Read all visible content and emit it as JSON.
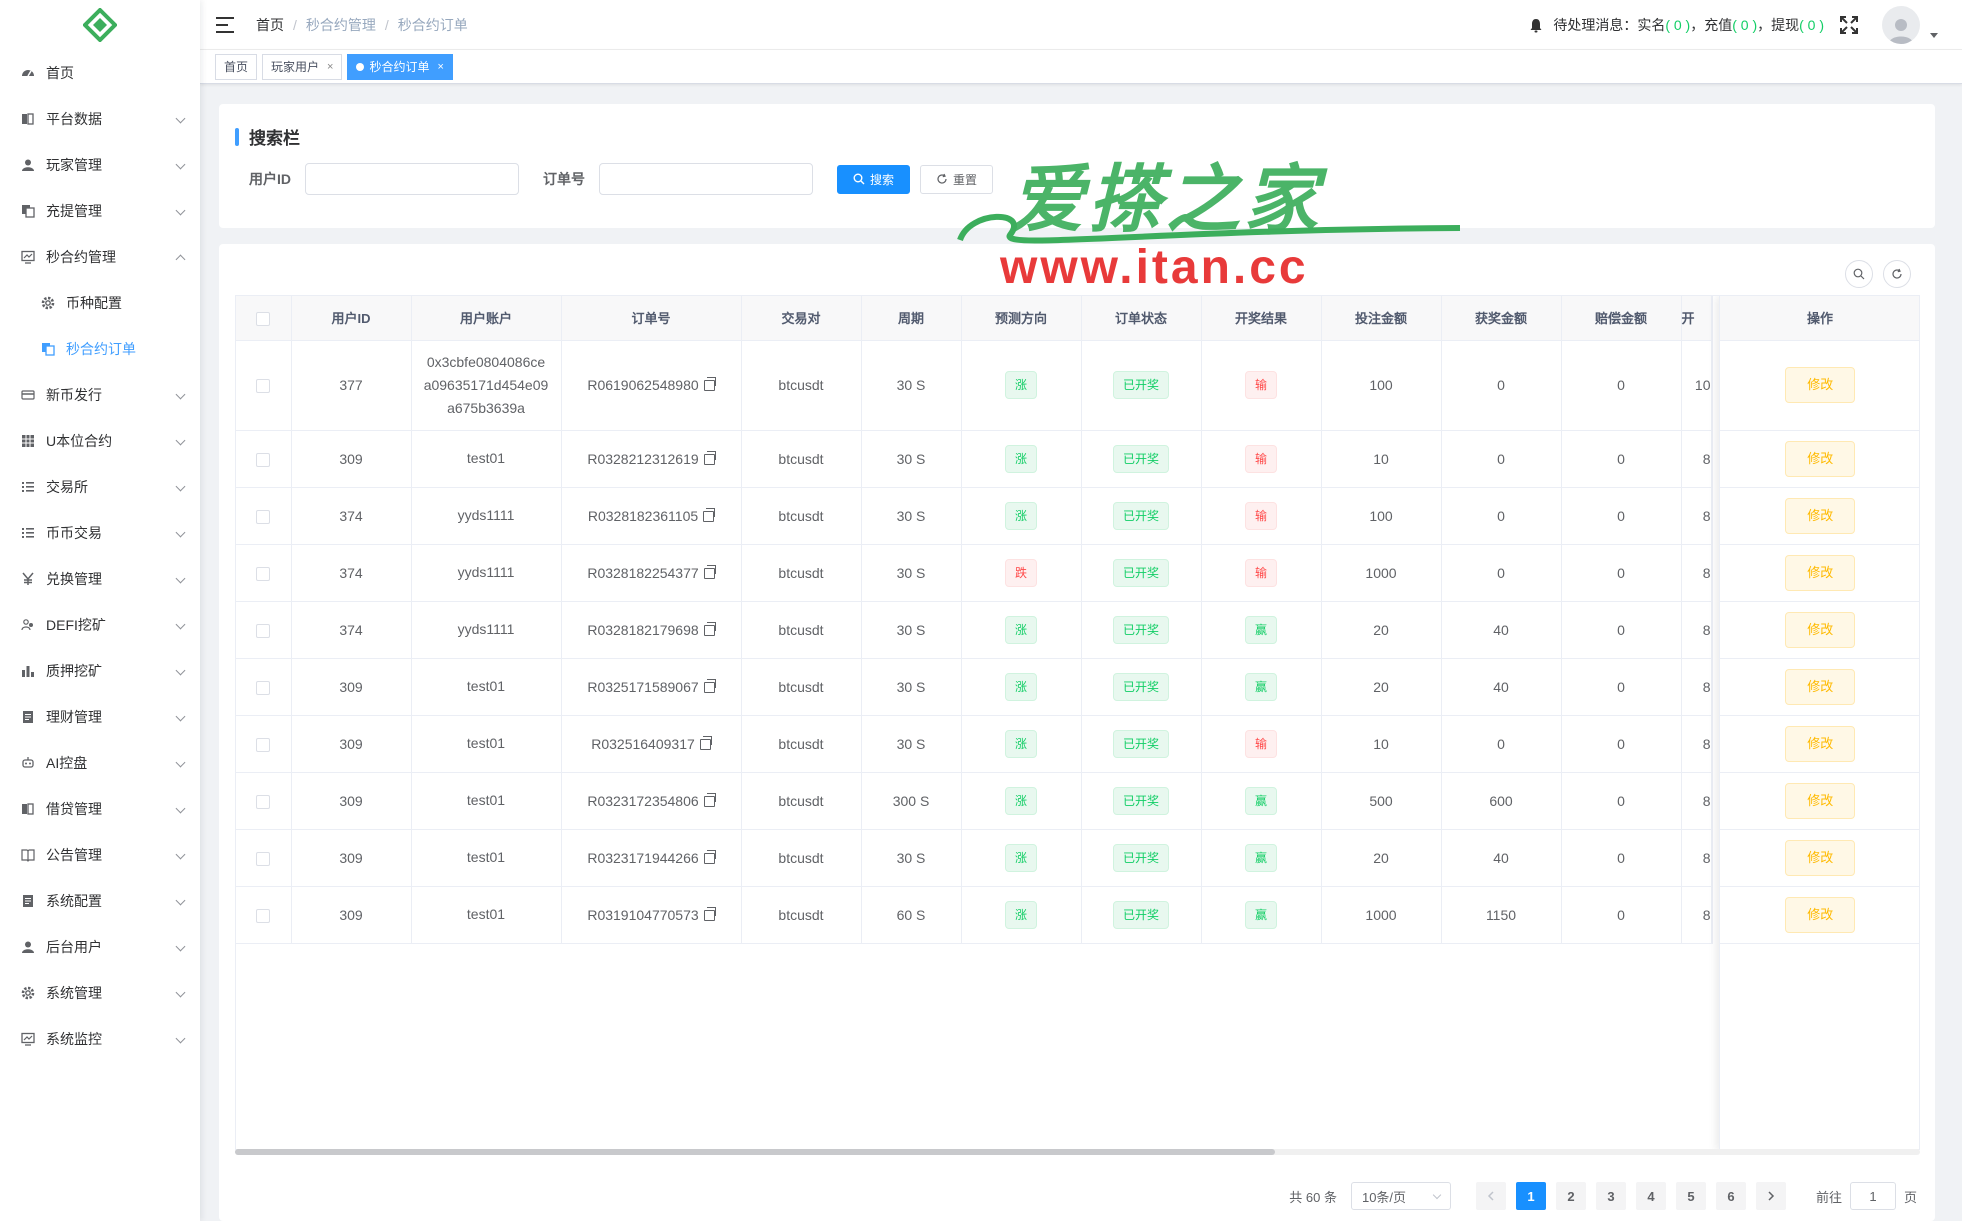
{
  "sidebar": {
    "items": [
      {
        "label": "首页",
        "icon": "dashboard-icon",
        "has_arrow": false
      },
      {
        "label": "平台数据",
        "icon": "book-icon",
        "has_arrow": true
      },
      {
        "label": "玩家管理",
        "icon": "user-icon",
        "has_arrow": true
      },
      {
        "label": "充提管理",
        "icon": "copy-icon",
        "has_arrow": true
      },
      {
        "label": "秒合约管理",
        "icon": "monitor-icon",
        "has_arrow": true,
        "expanded": true
      },
      {
        "label": "币种配置",
        "icon": "gear-icon",
        "sub": true
      },
      {
        "label": "秒合约订单",
        "icon": "copy-icon",
        "sub": true,
        "active": true
      },
      {
        "label": "新币发行",
        "icon": "card-icon",
        "has_arrow": true
      },
      {
        "label": "U本位合约",
        "icon": "grid-icon",
        "has_arrow": true
      },
      {
        "label": "交易所",
        "icon": "list-icon",
        "has_arrow": true
      },
      {
        "label": "币币交易",
        "icon": "list-icon",
        "has_arrow": true
      },
      {
        "label": "兑换管理",
        "icon": "yen-icon",
        "has_arrow": true
      },
      {
        "label": "DEFI挖矿",
        "icon": "people-icon",
        "has_arrow": true
      },
      {
        "label": "质押挖矿",
        "icon": "chart-icon",
        "has_arrow": true
      },
      {
        "label": "理财管理",
        "icon": "doc-icon",
        "has_arrow": true
      },
      {
        "label": "AI控盘",
        "icon": "robot-icon",
        "has_arrow": true
      },
      {
        "label": "借贷管理",
        "icon": "book-icon",
        "has_arrow": true
      },
      {
        "label": "公告管理",
        "icon": "open-book-icon",
        "has_arrow": true
      },
      {
        "label": "系统配置",
        "icon": "doc-icon",
        "has_arrow": true
      },
      {
        "label": "后台用户",
        "icon": "user-icon",
        "has_arrow": true
      },
      {
        "label": "系统管理",
        "icon": "gear-icon",
        "has_arrow": true
      },
      {
        "label": "系统监控",
        "icon": "monitor-icon",
        "has_arrow": true
      }
    ]
  },
  "header": {
    "breadcrumb": [
      "首页",
      "秒合约管理",
      "秒合约订单"
    ],
    "notice_prefix": "待处理消息：实名",
    "notice_realname": "( 0 )",
    "notice_sep1": "，充值",
    "notice_recharge": "( 0 )",
    "notice_sep2": "，提现",
    "notice_withdraw": "( 0 )"
  },
  "tags": [
    {
      "label": "首页",
      "closable": false,
      "active": false
    },
    {
      "label": "玩家用户",
      "closable": true,
      "active": false
    },
    {
      "label": "秒合约订单",
      "closable": true,
      "active": true
    }
  ],
  "search": {
    "title": "搜索栏",
    "user_id_label": "用户ID",
    "user_id_value": "",
    "order_label": "订单号",
    "order_value": "",
    "search_btn": "搜索",
    "reset_btn": "重置"
  },
  "table": {
    "columns": [
      "用户ID",
      "用户账户",
      "订单号",
      "交易对",
      "周期",
      "预测方向",
      "订单状态",
      "开奖结果",
      "投注金额",
      "获奖金额",
      "赔偿金额",
      "开"
    ],
    "action_column": "操作",
    "edit_label": "修改",
    "rows": [
      {
        "uid": "377",
        "account": "0x3cbfe0804086cea09635171d454e09a675b3639a",
        "order": "R0619062548980",
        "pair": "btcusdt",
        "period": "30 S",
        "direction": "涨",
        "status": "已开奖",
        "result": "输",
        "bet": "100",
        "win": "0",
        "comp": "0",
        "open": "10"
      },
      {
        "uid": "309",
        "account": "test01",
        "order": "R0328212312619",
        "pair": "btcusdt",
        "period": "30 S",
        "direction": "涨",
        "status": "已开奖",
        "result": "输",
        "bet": "10",
        "win": "0",
        "comp": "0",
        "open": "8"
      },
      {
        "uid": "374",
        "account": "yyds1111",
        "order": "R0328182361105",
        "pair": "btcusdt",
        "period": "30 S",
        "direction": "涨",
        "status": "已开奖",
        "result": "输",
        "bet": "100",
        "win": "0",
        "comp": "0",
        "open": "8"
      },
      {
        "uid": "374",
        "account": "yyds1111",
        "order": "R0328182254377",
        "pair": "btcusdt",
        "period": "30 S",
        "direction": "跌",
        "status": "已开奖",
        "result": "输",
        "bet": "1000",
        "win": "0",
        "comp": "0",
        "open": "8"
      },
      {
        "uid": "374",
        "account": "yyds1111",
        "order": "R0328182179698",
        "pair": "btcusdt",
        "period": "30 S",
        "direction": "涨",
        "status": "已开奖",
        "result": "赢",
        "bet": "20",
        "win": "40",
        "comp": "0",
        "open": "8"
      },
      {
        "uid": "309",
        "account": "test01",
        "order": "R0325171589067",
        "pair": "btcusdt",
        "period": "30 S",
        "direction": "涨",
        "status": "已开奖",
        "result": "赢",
        "bet": "20",
        "win": "40",
        "comp": "0",
        "open": "8"
      },
      {
        "uid": "309",
        "account": "test01",
        "order": "R032516409317",
        "pair": "btcusdt",
        "period": "30 S",
        "direction": "涨",
        "status": "已开奖",
        "result": "输",
        "bet": "10",
        "win": "0",
        "comp": "0",
        "open": "8"
      },
      {
        "uid": "309",
        "account": "test01",
        "order": "R0323172354806",
        "pair": "btcusdt",
        "period": "300 S",
        "direction": "涨",
        "status": "已开奖",
        "result": "赢",
        "bet": "500",
        "win": "600",
        "comp": "0",
        "open": "8"
      },
      {
        "uid": "309",
        "account": "test01",
        "order": "R0323171944266",
        "pair": "btcusdt",
        "period": "30 S",
        "direction": "涨",
        "status": "已开奖",
        "result": "赢",
        "bet": "20",
        "win": "40",
        "comp": "0",
        "open": "8"
      },
      {
        "uid": "309",
        "account": "test01",
        "order": "R0319104770573",
        "pair": "btcusdt",
        "period": "60 S",
        "direction": "涨",
        "status": "已开奖",
        "result": "赢",
        "bet": "1000",
        "win": "1150",
        "comp": "0",
        "open": "8"
      }
    ]
  },
  "pagination": {
    "total": "共 60 条",
    "page_size": "10条/页",
    "pages": [
      "1",
      "2",
      "3",
      "4",
      "5",
      "6"
    ],
    "current": "1",
    "goto_label": "前往",
    "goto_value": "1",
    "goto_suffix": "页"
  },
  "watermark": {
    "text": "爱搽之家",
    "url": "www.itan.cc"
  },
  "colors": {
    "primary": "#1890ff",
    "success": "#13ce66",
    "danger": "#ff4949",
    "warning": "#ffba00"
  }
}
